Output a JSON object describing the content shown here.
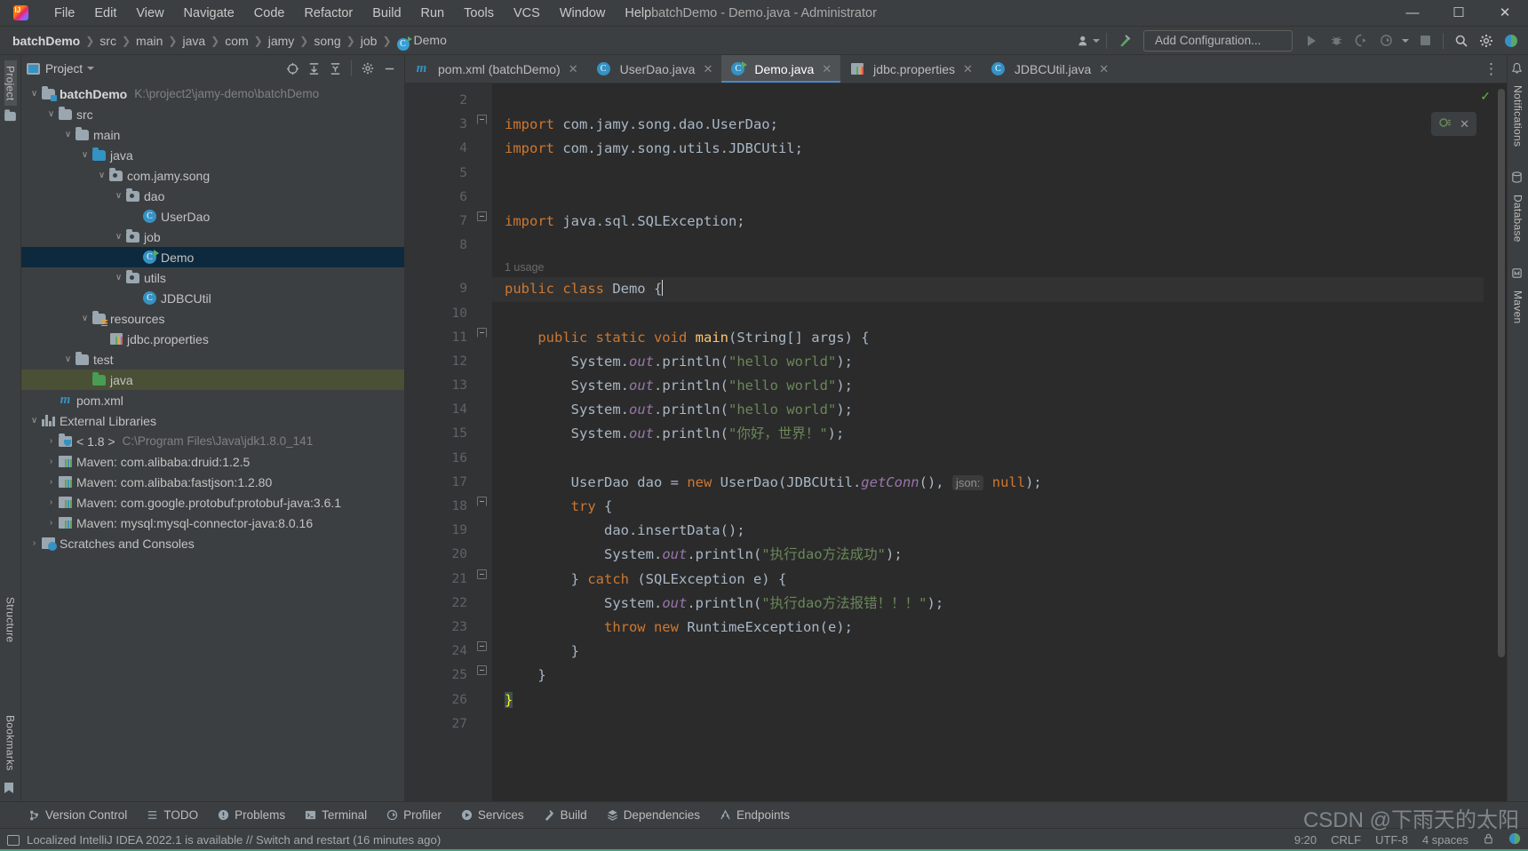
{
  "window": {
    "title": "batchDemo - Demo.java - Administrator",
    "controls": {
      "minimize": "—",
      "maximize": "☐",
      "close": "✕"
    }
  },
  "menubar": [
    {
      "label": "File"
    },
    {
      "label": "Edit"
    },
    {
      "label": "View"
    },
    {
      "label": "Navigate"
    },
    {
      "label": "Code"
    },
    {
      "label": "Refactor"
    },
    {
      "label": "Build"
    },
    {
      "label": "Run"
    },
    {
      "label": "Tools"
    },
    {
      "label": "VCS"
    },
    {
      "label": "Window"
    },
    {
      "label": "Help"
    }
  ],
  "breadcrumb": [
    {
      "label": "batchDemo",
      "bold": true
    },
    {
      "label": "src"
    },
    {
      "label": "main"
    },
    {
      "label": "java"
    },
    {
      "label": "com"
    },
    {
      "label": "jamy"
    },
    {
      "label": "song"
    },
    {
      "label": "job"
    },
    {
      "label": "Demo",
      "icon": "java-class-runnable-icon"
    }
  ],
  "toolbar": {
    "run_configuration": "Add Configuration...",
    "icons": [
      {
        "name": "user-account-icon"
      },
      {
        "name": "build-hammer-icon"
      },
      {
        "name": "run-icon"
      },
      {
        "name": "debug-icon"
      },
      {
        "name": "run-with-coverage-icon"
      },
      {
        "name": "profiler-icon"
      },
      {
        "name": "stop-icon"
      },
      {
        "name": "search-everywhere-icon"
      },
      {
        "name": "settings-gear-icon"
      },
      {
        "name": "ide-assistant-icon"
      }
    ]
  },
  "left_rail": {
    "items": [
      {
        "label": "Project",
        "selected": true
      },
      {
        "label": "Structure",
        "selected": false
      },
      {
        "label": "Bookmarks",
        "selected": false
      }
    ]
  },
  "right_rail": {
    "items": [
      {
        "label": "Notifications"
      },
      {
        "label": "Database"
      },
      {
        "label": "Maven"
      }
    ]
  },
  "project_panel": {
    "title": "Project",
    "header_icons": [
      {
        "name": "select-opened-file-icon"
      },
      {
        "name": "expand-all-icon"
      },
      {
        "name": "collapse-all-icon"
      },
      {
        "name": "settings-gear-icon"
      },
      {
        "name": "hide-panel-icon"
      }
    ],
    "tree": [
      {
        "depth": 0,
        "twist": "∨",
        "icon": "project-folder-icon",
        "label": "batchDemo",
        "bold": true,
        "path": "K:\\project2\\jamy-demo\\batchDemo"
      },
      {
        "depth": 1,
        "twist": "∨",
        "icon": "folder-icon",
        "label": "src"
      },
      {
        "depth": 2,
        "twist": "∨",
        "icon": "folder-icon",
        "label": "main"
      },
      {
        "depth": 3,
        "twist": "∨",
        "icon": "source-folder-icon",
        "label": "java"
      },
      {
        "depth": 4,
        "twist": "∨",
        "icon": "package-icon",
        "label": "com.jamy.song"
      },
      {
        "depth": 5,
        "twist": "∨",
        "icon": "package-icon",
        "label": "dao"
      },
      {
        "depth": 6,
        "twist": "",
        "icon": "java-class-icon",
        "label": "UserDao"
      },
      {
        "depth": 5,
        "twist": "∨",
        "icon": "package-icon",
        "label": "job"
      },
      {
        "depth": 6,
        "twist": "",
        "icon": "java-class-runnable-icon",
        "label": "Demo",
        "selected": "blue"
      },
      {
        "depth": 5,
        "twist": "∨",
        "icon": "package-icon",
        "label": "utils"
      },
      {
        "depth": 6,
        "twist": "",
        "icon": "java-class-icon",
        "label": "JDBCUtil"
      },
      {
        "depth": 3,
        "twist": "∨",
        "icon": "resources-folder-icon",
        "label": "resources"
      },
      {
        "depth": 4,
        "twist": "",
        "icon": "properties-file-icon",
        "label": "jdbc.properties"
      },
      {
        "depth": 2,
        "twist": "∨",
        "icon": "folder-icon",
        "label": "test"
      },
      {
        "depth": 3,
        "twist": "",
        "icon": "test-source-folder-icon",
        "label": "java",
        "selected": "green"
      },
      {
        "depth": 1,
        "twist": "",
        "icon": "maven-pom-icon",
        "label": "pom.xml"
      },
      {
        "depth": 0,
        "twist": "∨",
        "icon": "external-libraries-icon",
        "label": "External Libraries"
      },
      {
        "depth": 1,
        "twist": "›",
        "icon": "jdk-icon",
        "label": "< 1.8 >",
        "path": "C:\\Program Files\\Java\\jdk1.8.0_141"
      },
      {
        "depth": 1,
        "twist": "›",
        "icon": "maven-library-icon",
        "label": "Maven: com.alibaba:druid:1.2.5"
      },
      {
        "depth": 1,
        "twist": "›",
        "icon": "maven-library-icon",
        "label": "Maven: com.alibaba:fastjson:1.2.80"
      },
      {
        "depth": 1,
        "twist": "›",
        "icon": "maven-library-icon",
        "label": "Maven: com.google.protobuf:protobuf-java:3.6.1"
      },
      {
        "depth": 1,
        "twist": "›",
        "icon": "maven-library-icon",
        "label": "Maven: mysql:mysql-connector-java:8.0.16"
      },
      {
        "depth": 0,
        "twist": "›",
        "icon": "scratches-icon",
        "label": "Scratches and Consoles"
      }
    ]
  },
  "editor": {
    "tabs": [
      {
        "label": "pom.xml (batchDemo)",
        "icon": "maven-pom-icon",
        "active": false,
        "closable": true
      },
      {
        "label": "UserDao.java",
        "icon": "java-class-icon",
        "active": false,
        "closable": true
      },
      {
        "label": "Demo.java",
        "icon": "java-class-runnable-icon",
        "active": true,
        "closable": true
      },
      {
        "label": "jdbc.properties",
        "icon": "properties-file-icon",
        "active": false,
        "closable": true
      },
      {
        "label": "JDBCUtil.java",
        "icon": "java-class-icon",
        "active": false,
        "closable": true
      }
    ],
    "tabs_overflow_icon": "more-options-icon",
    "inspection_widget": {
      "icon": "inspections-widget-icon",
      "close": "✕"
    },
    "status_check": "✓",
    "first_line_number": 2,
    "usage_hint": "1 usage",
    "lines": [
      {
        "n": 2,
        "tokens": []
      },
      {
        "n": 3,
        "fold": "open",
        "tokens": [
          {
            "t": "import",
            "c": "kw"
          },
          {
            "t": " com.jamy.song.dao.UserDao;",
            "c": "typ"
          }
        ]
      },
      {
        "n": 4,
        "tokens": [
          {
            "t": "import",
            "c": "kw"
          },
          {
            "t": " com.jamy.song.utils.JDBCUtil;",
            "c": "typ"
          }
        ]
      },
      {
        "n": 5,
        "tokens": []
      },
      {
        "n": 6,
        "tokens": []
      },
      {
        "n": 7,
        "fold": "close",
        "tokens": [
          {
            "t": "import",
            "c": "kw"
          },
          {
            "t": " java.sql.SQLException;",
            "c": "typ"
          }
        ]
      },
      {
        "n": 8,
        "tokens": []
      },
      {
        "n": 9,
        "run": true,
        "hl": true,
        "usage": "1 usage",
        "tokens": [
          {
            "t": "public class",
            "c": "kw"
          },
          {
            "t": " Demo ",
            "c": "typ"
          },
          {
            "t": "{",
            "c": "brace"
          }
        ]
      },
      {
        "n": 10,
        "tokens": []
      },
      {
        "n": 11,
        "run": true,
        "fold": "open",
        "indent": 1,
        "tokens": [
          {
            "t": "public static void",
            "c": "kw"
          },
          {
            "t": " ",
            "c": "typ"
          },
          {
            "t": "main",
            "c": "mth"
          },
          {
            "t": "(String[] args) {",
            "c": "typ"
          }
        ]
      },
      {
        "n": 12,
        "indent": 2,
        "tokens": [
          {
            "t": "System.",
            "c": "typ"
          },
          {
            "t": "out",
            "c": "fld"
          },
          {
            "t": ".println(",
            "c": "typ"
          },
          {
            "t": "\"hello world\"",
            "c": "str"
          },
          {
            "t": ");",
            "c": "typ"
          }
        ]
      },
      {
        "n": 13,
        "indent": 2,
        "tokens": [
          {
            "t": "System.",
            "c": "typ"
          },
          {
            "t": "out",
            "c": "fld"
          },
          {
            "t": ".println(",
            "c": "typ"
          },
          {
            "t": "\"hello world\"",
            "c": "str"
          },
          {
            "t": ");",
            "c": "typ"
          }
        ]
      },
      {
        "n": 14,
        "indent": 2,
        "tokens": [
          {
            "t": "System.",
            "c": "typ"
          },
          {
            "t": "out",
            "c": "fld"
          },
          {
            "t": ".println(",
            "c": "typ"
          },
          {
            "t": "\"hello world\"",
            "c": "str"
          },
          {
            "t": ");",
            "c": "typ"
          }
        ]
      },
      {
        "n": 15,
        "indent": 2,
        "tokens": [
          {
            "t": "System.",
            "c": "typ"
          },
          {
            "t": "out",
            "c": "fld"
          },
          {
            "t": ".println(",
            "c": "typ"
          },
          {
            "t": "\"你好，世界！\"",
            "c": "str"
          },
          {
            "t": ");",
            "c": "typ"
          }
        ]
      },
      {
        "n": 16,
        "tokens": []
      },
      {
        "n": 17,
        "indent": 2,
        "tokens": [
          {
            "t": "UserDao dao = ",
            "c": "typ"
          },
          {
            "t": "new",
            "c": "kw"
          },
          {
            "t": " UserDao(JDBCUtil.",
            "c": "typ"
          },
          {
            "t": "getConn",
            "c": "fld"
          },
          {
            "t": "(), ",
            "c": "typ"
          },
          {
            "t": "json:",
            "c": "hint"
          },
          {
            "t": " ",
            "c": "typ"
          },
          {
            "t": "null",
            "c": "kw"
          },
          {
            "t": ");",
            "c": "typ"
          }
        ]
      },
      {
        "n": 18,
        "fold": "open",
        "indent": 2,
        "tokens": [
          {
            "t": "try",
            "c": "kw"
          },
          {
            "t": " {",
            "c": "typ"
          }
        ]
      },
      {
        "n": 19,
        "indent": 3,
        "tokens": [
          {
            "t": "dao.insertData();",
            "c": "typ"
          }
        ]
      },
      {
        "n": 20,
        "indent": 3,
        "tokens": [
          {
            "t": "System.",
            "c": "typ"
          },
          {
            "t": "out",
            "c": "fld"
          },
          {
            "t": ".println(",
            "c": "typ"
          },
          {
            "t": "\"执行dao方法成功\"",
            "c": "str"
          },
          {
            "t": ");",
            "c": "typ"
          }
        ]
      },
      {
        "n": 21,
        "fold": "close",
        "indent": 2,
        "tokens": [
          {
            "t": "} ",
            "c": "typ"
          },
          {
            "t": "catch",
            "c": "kw"
          },
          {
            "t": " (SQLException e) {",
            "c": "typ"
          }
        ]
      },
      {
        "n": 22,
        "indent": 3,
        "tokens": [
          {
            "t": "System.",
            "c": "typ"
          },
          {
            "t": "out",
            "c": "fld"
          },
          {
            "t": ".println(",
            "c": "typ"
          },
          {
            "t": "\"执行dao方法报错！！！\"",
            "c": "str"
          },
          {
            "t": ");",
            "c": "typ"
          }
        ]
      },
      {
        "n": 23,
        "indent": 3,
        "tokens": [
          {
            "t": "throw new",
            "c": "kw"
          },
          {
            "t": " RuntimeException(e);",
            "c": "typ"
          }
        ]
      },
      {
        "n": 24,
        "fold": "close",
        "indent": 2,
        "tokens": [
          {
            "t": "}",
            "c": "typ"
          }
        ]
      },
      {
        "n": 25,
        "fold": "close",
        "indent": 1,
        "tokens": [
          {
            "t": "}",
            "c": "typ"
          }
        ]
      },
      {
        "n": 26,
        "indent": 0,
        "tokens": [
          {
            "t": "}",
            "c": "brace-y"
          }
        ]
      },
      {
        "n": 27,
        "tokens": []
      }
    ]
  },
  "bottom_tools": [
    {
      "label": "Version Control",
      "icon": "version-control-icon"
    },
    {
      "label": "TODO",
      "icon": "todo-icon"
    },
    {
      "label": "Problems",
      "icon": "problems-icon"
    },
    {
      "label": "Terminal",
      "icon": "terminal-icon"
    },
    {
      "label": "Profiler",
      "icon": "profiler-icon"
    },
    {
      "label": "Services",
      "icon": "services-icon"
    },
    {
      "label": "Build",
      "icon": "build-icon"
    },
    {
      "label": "Dependencies",
      "icon": "dependencies-icon"
    },
    {
      "label": "Endpoints",
      "icon": "endpoints-icon"
    }
  ],
  "statusbar": {
    "message": "Localized IntelliJ IDEA 2022.1 is available // Switch and restart (16 minutes ago)",
    "caret_position": "9:20",
    "line_separator": "CRLF",
    "encoding": "UTF-8",
    "indent": "4 spaces",
    "icons": [
      {
        "name": "lock-icon"
      },
      {
        "name": "ide-assistant-icon"
      }
    ]
  },
  "watermark": "CSDN @下雨天的太阳",
  "colors": {
    "chrome": "#3c3f41",
    "editor_bg": "#2b2b2b",
    "gutter_bg": "#313335",
    "accent_blue": "#4a88c7",
    "selection_blue": "#0d293e",
    "selection_green": "#4a5036",
    "keyword_orange": "#cc7832",
    "string_green": "#6a8759",
    "method_yellow": "#ffc66d",
    "field_purple": "#9876aa",
    "status_underline": "#4a9e7f"
  }
}
